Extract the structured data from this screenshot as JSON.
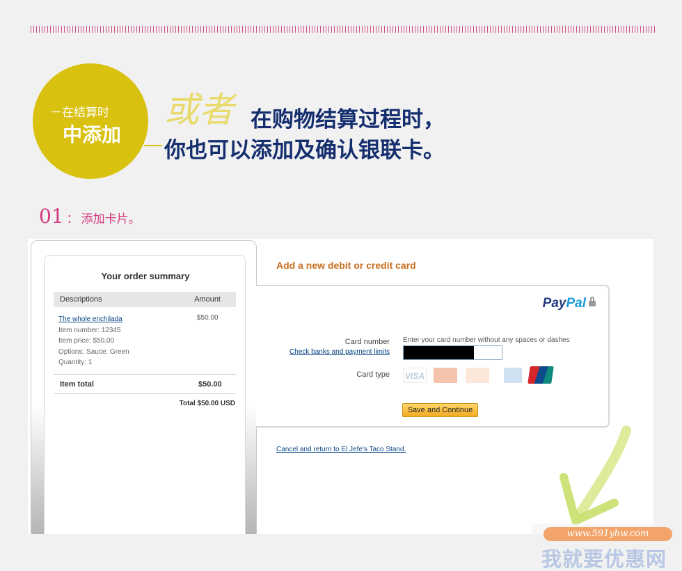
{
  "header": {
    "badge_line1": "－在结算时",
    "badge_line2": "中添加",
    "or_word": "或者",
    "headline_line1": "在购物结算过程时，",
    "headline_line2": "你也可以添加及确认银联卡。"
  },
  "step": {
    "number": "01",
    "sep": "：",
    "label": "添加卡片。"
  },
  "order_summary": {
    "title": "Your order summary",
    "col_desc": "Descriptions",
    "col_amount": "Amount",
    "item": {
      "name": "The whole enchilada",
      "number": "Item number: 12345",
      "price": "Item price: $50.00",
      "options": "Options: Sauce: Green",
      "quantity": "Quantity: 1",
      "amount": "$50.00"
    },
    "item_total_label": "Item total",
    "item_total_value": "$50.00",
    "grand_total": "Total $50.00 USD"
  },
  "payment": {
    "section_title": "Add a new debit or credit card",
    "logo_pay": "Pay",
    "logo_pal": "Pal",
    "card_number_label": "Card number",
    "check_banks_link": "Check banks and payment limits",
    "card_number_hint": "Enter your card number without any spaces or dashes",
    "card_type_label": "Card type",
    "card_types": [
      "VISA",
      "MasterCard",
      "DISCOVER",
      "AMEX",
      "UnionPay"
    ],
    "save_button": "Save and Continue",
    "cancel_link": "Cancel and return to El Jefe's Taco Stand."
  },
  "watermark": {
    "url": "www.591yhw.com",
    "name": "我就要优惠网"
  },
  "colors": {
    "badge": "#d8c10f",
    "headline": "#142e6e",
    "step": "#d23a7e",
    "accent_orange": "#c96f1e",
    "button": "#f3aa22"
  }
}
